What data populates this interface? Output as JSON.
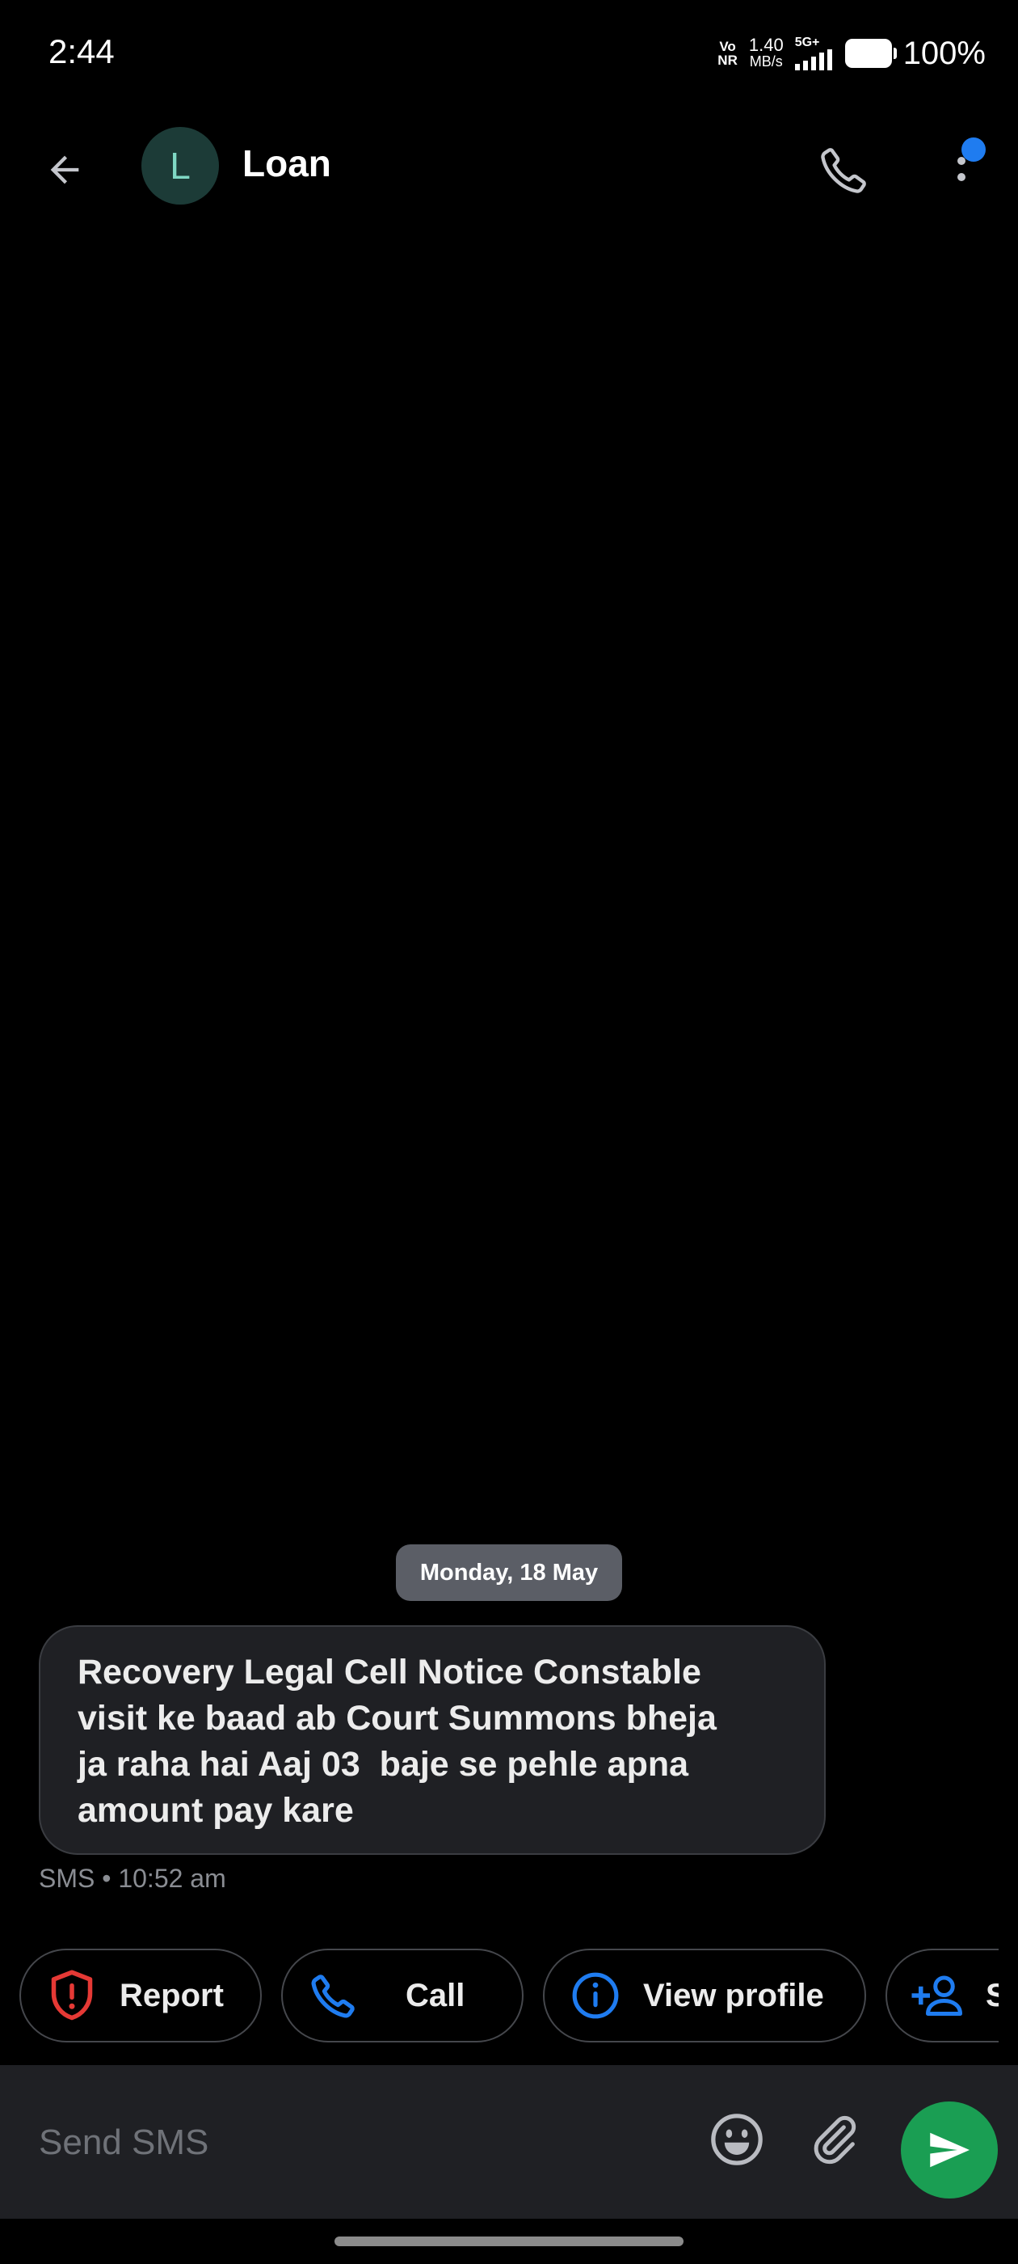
{
  "status_bar": {
    "time": "2:44",
    "volte_top": "Vo",
    "volte_bottom": "NR",
    "net_speed_value": "1.40",
    "net_speed_unit": "MB/s",
    "network_type": "5G+",
    "battery_percent": "100%"
  },
  "header": {
    "avatar_letter": "L",
    "contact_name": "Loan"
  },
  "conversation": {
    "date_label": "Monday, 18 May",
    "messages": [
      {
        "text": "Recovery Legal Cell Notice Constable\nvisit ke baad ab Court Summons bheja\nja raha hai Aaj 03  baje se pehle apna\namount pay kare",
        "meta": "SMS • 10:52 am"
      }
    ]
  },
  "suggestions": {
    "report": "Report",
    "call": "Call",
    "view_profile": "View profile",
    "save": "S"
  },
  "compose": {
    "placeholder": "Send SMS"
  },
  "colors": {
    "background": "#000000",
    "bubble": "#1f2024",
    "accent_blue": "#1f7cf0",
    "report_red": "#e53935",
    "send_green": "#1a9e53"
  }
}
